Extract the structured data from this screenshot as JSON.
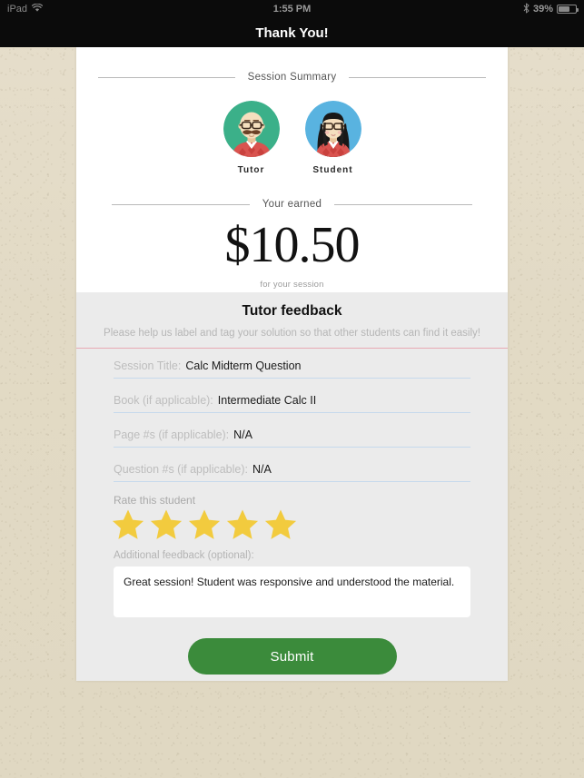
{
  "status_bar": {
    "device": "iPad",
    "wifi_icon": "wifi-icon",
    "time": "1:55 PM",
    "bluetooth_icon": "bluetooth-icon",
    "battery_percent": "39%",
    "battery_icon": "battery-icon"
  },
  "nav": {
    "title": "Thank You!"
  },
  "summary": {
    "heading": "Session Summary",
    "avatars": [
      {
        "label": "Tutor",
        "role": "tutor",
        "bg": "#3bb089"
      },
      {
        "label": "Student",
        "role": "student",
        "bg": "#59b3e0"
      }
    ],
    "earned_heading": "Your earned",
    "amount": "$10.50",
    "amount_sub": "for your session"
  },
  "feedback": {
    "title": "Tutor feedback",
    "subtitle": "Please help us label and tag your solution so that other students can find it easily!",
    "divider_color": "#e8aab4",
    "fields": [
      {
        "label": "Session Title:",
        "value": "Calc Midterm Question"
      },
      {
        "label": "Book (if applicable):",
        "value": "Intermediate Calc II"
      },
      {
        "label": "Page #s (if applicable):",
        "value": "N/A"
      },
      {
        "label": "Question #s (if applicable):",
        "value": "N/A"
      }
    ],
    "rate_label": "Rate this student",
    "rating": {
      "value": 5,
      "max": 5,
      "star_color": "#f2cb3e"
    },
    "textarea_label": "Additional feedback (optional):",
    "textarea_value": "Great session! Student was responsive and understood the material.",
    "textarea_placeholder": "",
    "submit_label": "Submit",
    "submit_color": "#3b8b3b"
  }
}
